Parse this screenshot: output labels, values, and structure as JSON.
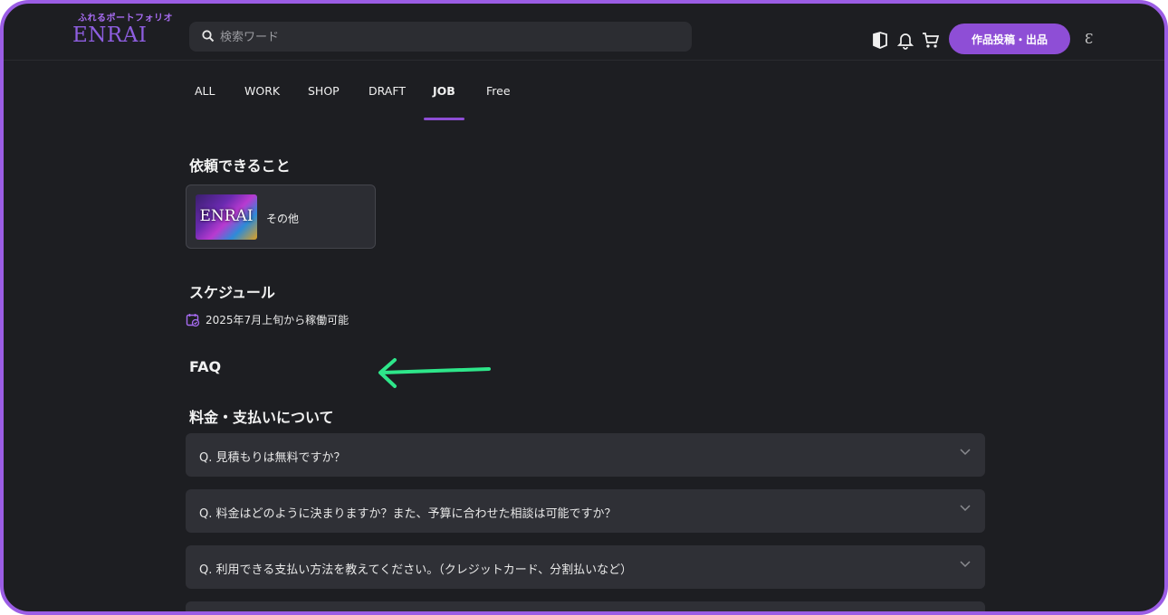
{
  "header": {
    "logo_sub": "ふれるポートフォリオ",
    "logo_main": "ENRAI",
    "search_placeholder": "検索ワード",
    "post_button": "作品投稿・出品",
    "avatar_text": "Ɛ",
    "icons": [
      "guide-book-icon",
      "bell-icon",
      "cart-icon"
    ]
  },
  "tabs": [
    {
      "label": "ALL",
      "active": false
    },
    {
      "label": "WORK",
      "active": false
    },
    {
      "label": "SHOP",
      "active": false
    },
    {
      "label": "DRAFT",
      "active": false
    },
    {
      "label": "JOB",
      "active": true
    },
    {
      "label": "Free",
      "active": false
    }
  ],
  "requests": {
    "title": "依頼できること",
    "items": [
      {
        "label": "その他",
        "thumb_text": "ENRAI"
      }
    ]
  },
  "schedule": {
    "title": "スケジュール",
    "text": "2025年7月上旬から稼働可能"
  },
  "faq": {
    "title": "FAQ",
    "category": "料金・支払いについて",
    "items": [
      {
        "q": "Q.  見積もりは無料ですか？"
      },
      {
        "q": "Q.  料金はどのように決まりますか？また、予算に合わせた相談は可能ですか？"
      },
      {
        "q": "Q.  利用できる支払い方法を教えてください。（クレジットカード、分割払いなど）"
      },
      {
        "q": ""
      }
    ]
  },
  "colors": {
    "accent": "#8e4ed6",
    "frame": "#9b5de5",
    "background": "#1d1e22",
    "annotation_arrow": "#2ee68a"
  }
}
